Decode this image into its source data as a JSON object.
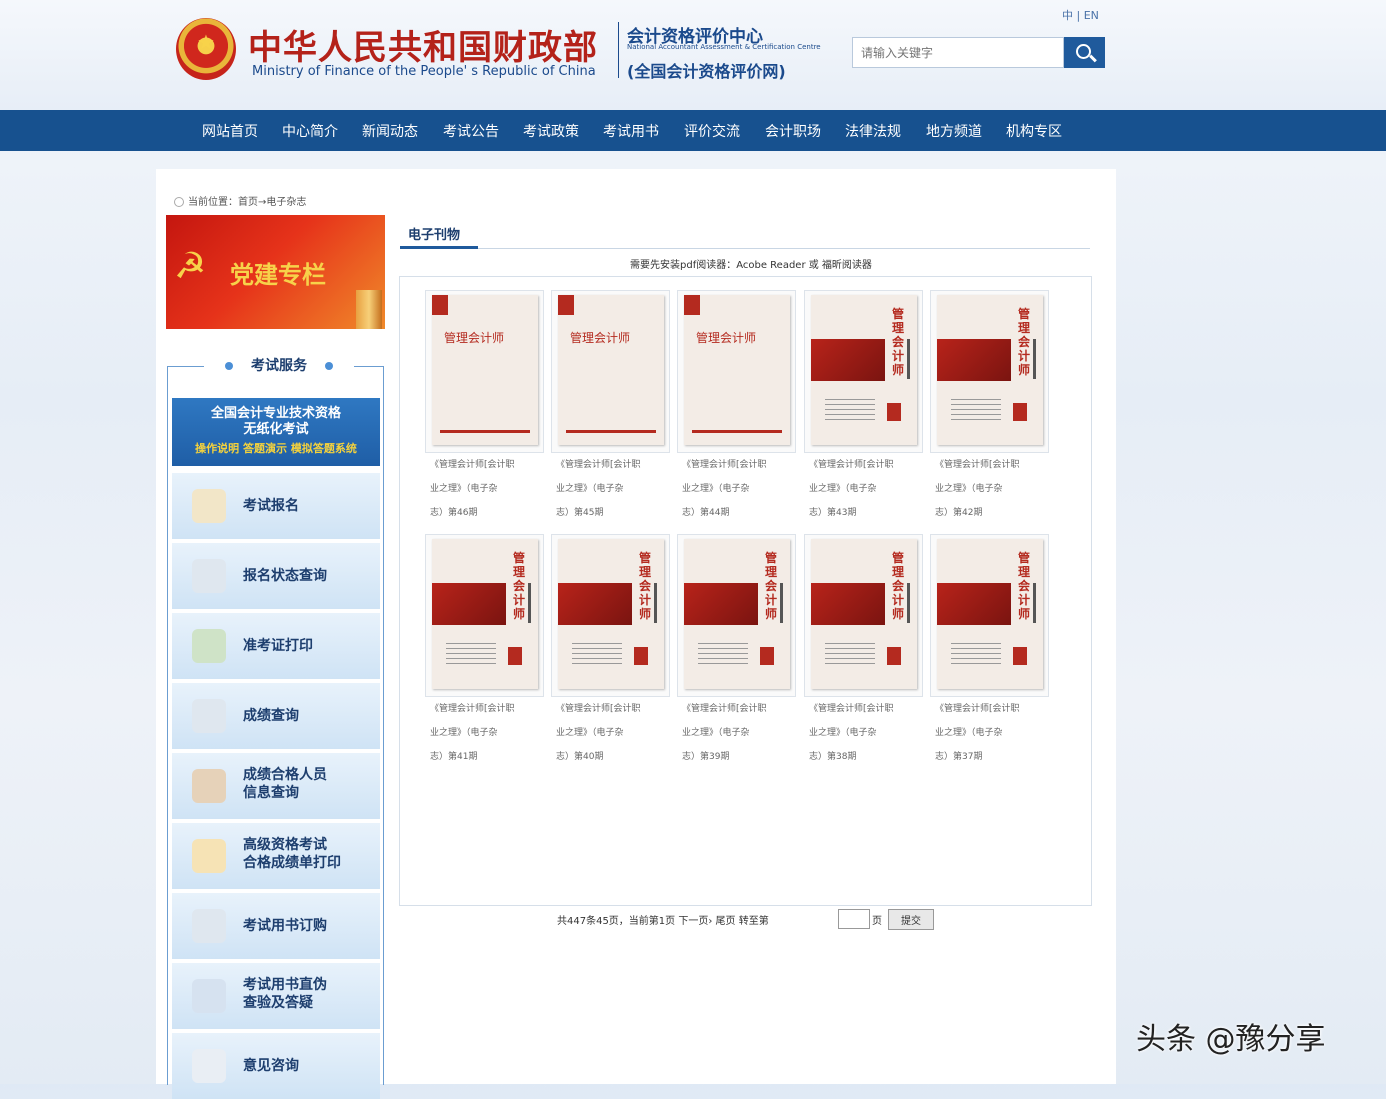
{
  "header": {
    "ministry_cn": "中华人民共和国财政部",
    "ministry_en": "Ministry of Finance of the People' s Republic of China",
    "center_cn": "会计资格评价中心",
    "center_en": "National Accountant Assessment & Certification Centre",
    "center_sub": "(全国会计资格评价网)",
    "lang": "中 | EN",
    "search_placeholder": "请输入关键字"
  },
  "nav": [
    "网站首页",
    "中心简介",
    "新闻动态",
    "考试公告",
    "考试政策",
    "考试用书",
    "评价交流",
    "会计职场",
    "法律法规",
    "地方频道",
    "机构专区"
  ],
  "breadcrumb": "当前位置：首页→电子杂志",
  "banner": {
    "text": "党建专栏"
  },
  "services": {
    "title": "考试服务",
    "paperless": [
      "全国会计专业技术资格",
      "无纸化考试",
      "操作说明 答题演示 模拟答题系统"
    ],
    "items": [
      {
        "lines": [
          "考试报名"
        ],
        "icon": "pencil-note-icon",
        "color": "#f2e6c8"
      },
      {
        "lines": [
          "报名状态查询"
        ],
        "icon": "magnifier-icon",
        "color": "#dfe7ef"
      },
      {
        "lines": [
          "准考证打印"
        ],
        "icon": "printer-icon",
        "color": "#cfe3c7"
      },
      {
        "lines": [
          "成绩查询"
        ],
        "icon": "magnifier-icon",
        "color": "#dfe7ef"
      },
      {
        "lines": [
          "成绩合格人员",
          "信息查询"
        ],
        "icon": "inbox-icon",
        "color": "#e6d2b9"
      },
      {
        "lines": [
          "高级资格考试",
          "合格成绩单打印"
        ],
        "icon": "certificate-icon",
        "color": "#f6e3b5"
      },
      {
        "lines": [
          "考试用书订购"
        ],
        "icon": "magnifier-icon",
        "color": "#dfe7ef"
      },
      {
        "lines": [
          "考试用书直伪",
          "查验及答疑"
        ],
        "icon": "book-check-icon",
        "color": "#d6e2f0"
      },
      {
        "lines": [
          "意见咨询"
        ],
        "icon": "chat-bubble-icon",
        "color": "#e9eef4"
      }
    ]
  },
  "content": {
    "tab": "电子刊物",
    "notice": "需要先安装pdf阅读器：Acobe Reader 或 福昕阅读器",
    "cover_title": "管理会计师",
    "cover_title_vertical": "管理会计师",
    "magazines": [
      {
        "caption": [
          "《管理会计师[会计职",
          "业之理》（电子杂",
          "志）第46期"
        ],
        "style": "t1"
      },
      {
        "caption": [
          "《管理会计师[会计职",
          "业之理》（电子杂",
          "志）第45期"
        ],
        "style": "t1"
      },
      {
        "caption": [
          "《管理会计师[会计职",
          "业之理》（电子杂",
          "志）第44期"
        ],
        "style": "t1"
      },
      {
        "caption": [
          "《管理会计师[会计职",
          "业之理》（电子杂",
          "志）第43期"
        ],
        "style": "t2"
      },
      {
        "caption": [
          "《管理会计师[会计职",
          "业之理》（电子杂",
          "志）第42期"
        ],
        "style": "t2"
      },
      {
        "caption": [
          "《管理会计师[会计职",
          "业之理》（电子杂",
          "志）第41期"
        ],
        "style": "t2"
      },
      {
        "caption": [
          "《管理会计师[会计职",
          "业之理》（电子杂",
          "志）第40期"
        ],
        "style": "t2"
      },
      {
        "caption": [
          "《管理会计师[会计职",
          "业之理》（电子杂",
          "志）第39期"
        ],
        "style": "t2"
      },
      {
        "caption": [
          "《管理会计师[会计职",
          "业之理》（电子杂",
          "志）第38期"
        ],
        "style": "t2"
      },
      {
        "caption": [
          "《管理会计师[会计职",
          "业之理》（电子杂",
          "志）第37期"
        ],
        "style": "t2"
      }
    ],
    "pager": "共447条45页，当前第1页  下一页› 尾页  转至第",
    "pager_unit": "页",
    "submit": "提交"
  },
  "watermark": "头条 @豫分享"
}
